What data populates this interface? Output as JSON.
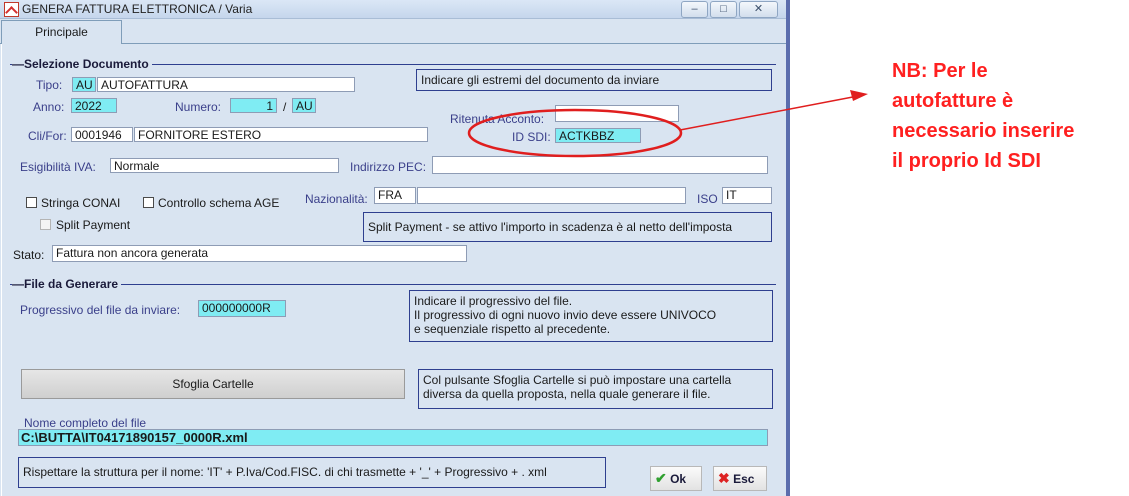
{
  "window": {
    "title": "GENERA FATTURA ELETTRONICA  / Varia",
    "minimize": "–",
    "maximize": "□",
    "close": "✕",
    "tab": "Principale"
  },
  "selezione": {
    "heading": "Selezione Documento",
    "tipo_label": "Tipo:",
    "tipo_code": "AU",
    "tipo_desc": "AUTOFATTURA",
    "anno_label": "Anno:",
    "anno": "2022",
    "numero_label": "Numero:",
    "numero": "1",
    "numero_sep": "/",
    "numero_suffix": "AU",
    "clifor_label": "Cli/For:",
    "clifor_code": "0001946",
    "clifor_name": "FORNITORE ESTERO",
    "note_estremi": "Indicare gli estremi del documento da inviare",
    "ritenuta_label": "Ritenuta Acconto:",
    "ritenuta": "",
    "idsdi_label": "ID SDI:",
    "idsdi": "ACTKBBZ",
    "esigibilita_label": "Esigibilità IVA:",
    "esigibilita": "Normale",
    "pec_label": "Indirizzo PEC:",
    "pec": "",
    "stringa_conai": "Stringa CONAI",
    "controllo_schema": "Controllo schema AGE",
    "split_payment": "Split Payment",
    "nazionalita_label": "Nazionalità:",
    "nazionalita": "FRA",
    "nazionalita_desc": "",
    "iso_label": "ISO",
    "iso": "IT",
    "note_split": "Split Payment - se attivo l'importo in scadenza è al netto dell'imposta",
    "stato_label": "Stato:",
    "stato": "Fattura non ancora generata"
  },
  "file": {
    "heading": "File da Generare",
    "progressivo_label": "Progressivo del file da inviare:",
    "progressivo": "000000000R",
    "note_progressivo_1": "Indicare il progressivo del file.",
    "note_progressivo_2": "Il progressivo di ogni nuovo invio deve essere UNIVOCO",
    "note_progressivo_3": "e sequenziale rispetto al precedente.",
    "sfoglia_button": "Sfoglia Cartelle",
    "note_sfoglia_1": "Col pulsante Sfoglia Cartelle si può impostare una cartella",
    "note_sfoglia_2": "diversa da quella proposta, nella quale generare il file.",
    "nome_label": "Nome completo del file",
    "nome": "C:\\BUTTA\\IT04171890157_0000R.xml",
    "note_nome": "Rispettare la struttura per il nome:  'IT' +  P.Iva/Cod.FISC. di chi trasmette  + '_' + Progressivo + . xml"
  },
  "buttons": {
    "ok": "Ok",
    "esc": "Esc"
  },
  "annotation": {
    "line1": "NB: Per le",
    "line2": "autofatture è",
    "line3": "necessario inserire",
    "line4": "il proprio Id SDI",
    "color": "#ff2020"
  }
}
